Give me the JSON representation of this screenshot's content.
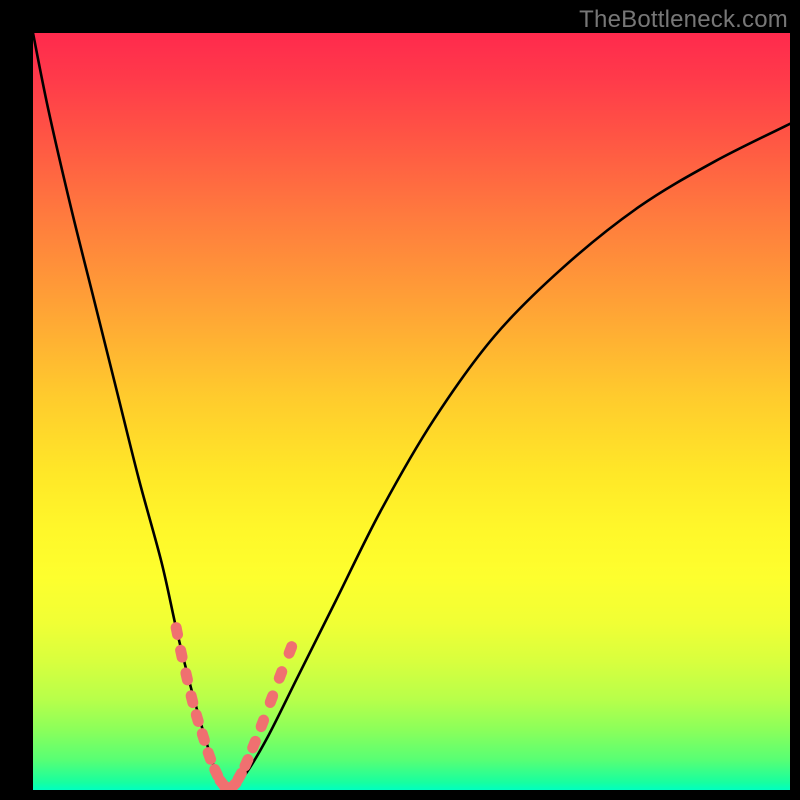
{
  "watermark": "TheBottleneck.com",
  "colors": {
    "background": "#000000",
    "curve": "#000000",
    "marker_fill": "#f07070",
    "marker_stroke": "#c05050"
  },
  "chart_data": {
    "type": "line",
    "title": "",
    "xlabel": "",
    "ylabel": "",
    "xlim": [
      0,
      100
    ],
    "ylim": [
      0,
      100
    ],
    "grid": false,
    "legend": false,
    "background_gradient": {
      "direction": "vertical",
      "top_color": "#ff2a4d",
      "bottom_color": "#00ffc0",
      "meaning": "gradient from red (high bottleneck) at top to green (no bottleneck) at bottom"
    },
    "series": [
      {
        "name": "bottleneck-curve",
        "x": [
          0,
          2,
          5,
          8,
          11,
          14,
          17,
          19,
          21,
          23,
          24.5,
          26,
          28,
          31,
          35,
          40,
          46,
          53,
          61,
          70,
          80,
          90,
          100
        ],
        "y": [
          100,
          90,
          77,
          65,
          53,
          41,
          30,
          21,
          13,
          6,
          1.5,
          0,
          2,
          7,
          15,
          25,
          37,
          49,
          60,
          69,
          77,
          83,
          88
        ]
      }
    ],
    "markers": {
      "name": "highlighted-points",
      "description": "pink rounded markers clustered near the valley minimum on both slopes",
      "points": [
        {
          "x": 19.0,
          "y": 21.0
        },
        {
          "x": 19.6,
          "y": 18.0
        },
        {
          "x": 20.3,
          "y": 15.0
        },
        {
          "x": 21.0,
          "y": 12.0
        },
        {
          "x": 21.7,
          "y": 9.5
        },
        {
          "x": 22.5,
          "y": 7.0
        },
        {
          "x": 23.3,
          "y": 4.5
        },
        {
          "x": 24.2,
          "y": 2.3
        },
        {
          "x": 25.0,
          "y": 0.9
        },
        {
          "x": 25.8,
          "y": 0.3
        },
        {
          "x": 26.5,
          "y": 0.6
        },
        {
          "x": 27.3,
          "y": 1.8
        },
        {
          "x": 28.2,
          "y": 3.6
        },
        {
          "x": 29.2,
          "y": 6.0
        },
        {
          "x": 30.3,
          "y": 8.8
        },
        {
          "x": 31.5,
          "y": 12.0
        },
        {
          "x": 32.7,
          "y": 15.2
        },
        {
          "x": 34.0,
          "y": 18.5
        }
      ]
    }
  }
}
